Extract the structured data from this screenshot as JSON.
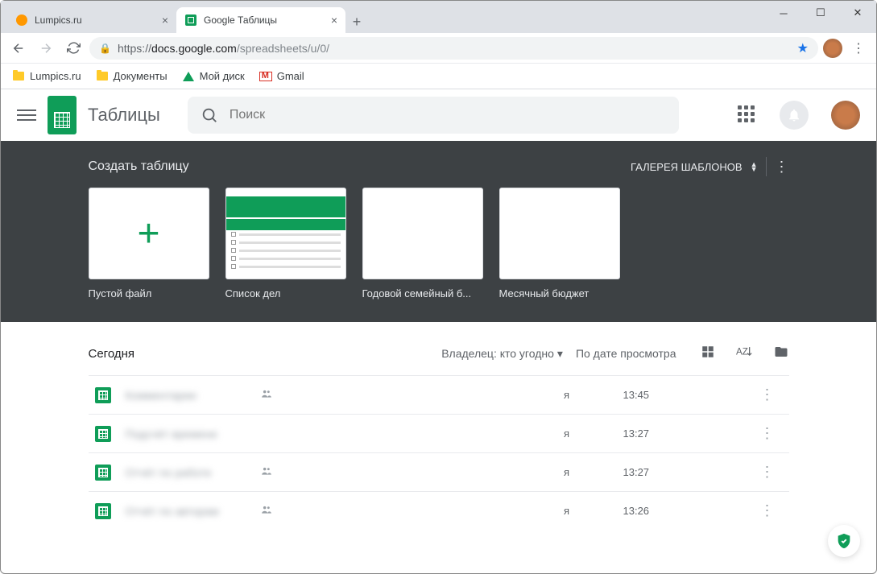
{
  "window": {
    "tabs": [
      {
        "title": "Lumpics.ru"
      },
      {
        "title": "Google Таблицы"
      }
    ]
  },
  "address": {
    "protocol": "https://",
    "host": "docs.google.com",
    "path": "/spreadsheets/u/0/"
  },
  "bookmarks": [
    {
      "label": "Lumpics.ru",
      "icon": "folder"
    },
    {
      "label": "Документы",
      "icon": "folder"
    },
    {
      "label": "Мой диск",
      "icon": "drive"
    },
    {
      "label": "Gmail",
      "icon": "gmail"
    }
  ],
  "app": {
    "title": "Таблицы",
    "search_placeholder": "Поиск"
  },
  "gallery": {
    "heading": "Создать таблицу",
    "toggle_label": "ГАЛЕРЕЯ ШАБЛОНОВ",
    "templates": [
      {
        "label": "Пустой файл"
      },
      {
        "label": "Список дел"
      },
      {
        "label": "Годовой семейный б..."
      },
      {
        "label": "Месячный бюджет"
      }
    ]
  },
  "list": {
    "section": "Сегодня",
    "owner_filter": "Владелец: кто угодно",
    "sort_label": "По дате просмотра",
    "files": [
      {
        "name": "Комментарии",
        "shared": true,
        "owner": "я",
        "time": "13:45"
      },
      {
        "name": "Подсчёт времени",
        "shared": false,
        "owner": "я",
        "time": "13:27"
      },
      {
        "name": "Отчёт по работе",
        "shared": true,
        "owner": "я",
        "time": "13:27"
      },
      {
        "name": "Отчёт по авторам",
        "shared": true,
        "owner": "я",
        "time": "13:26"
      }
    ]
  }
}
